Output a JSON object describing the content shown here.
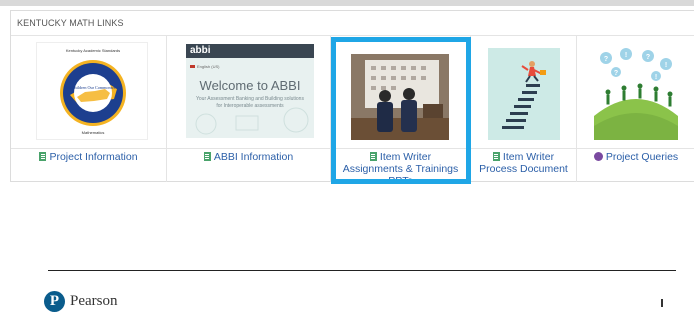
{
  "section": {
    "title": "KENTUCKY MATH LINKS"
  },
  "tiles": [
    {
      "label": "Project Information",
      "icon": "document-icon",
      "seal": {
        "top": "Kentucky Academic Standards",
        "ring": "Kentucky Department of Education",
        "center": "Our Children Our Commonwealth",
        "bottom": "Mathematics"
      }
    },
    {
      "label": "ABBI Information",
      "icon": "document-icon",
      "abbi": {
        "logo": "abbi",
        "welcome": "Welcome to ABBI",
        "subtitle": "Your Assessment Banking and Building solutions for Interoperable assessments",
        "lang": "English (US)"
      }
    },
    {
      "label": "Item Writer Assignments & Trainings PPTs",
      "icon": "document-icon"
    },
    {
      "label": "Item Writer Process Document",
      "icon": "document-icon"
    },
    {
      "label": "Project Queries",
      "icon": "query-icon"
    }
  ],
  "footer": {
    "brand": "Pearson",
    "logo_letter": "P"
  },
  "colors": {
    "link": "#2b5fa8",
    "highlight": "#1fa6e6",
    "doc_icon": "#4aa36b",
    "query_icon": "#7a4aa0",
    "pearson_blue": "#0a5c8c"
  }
}
